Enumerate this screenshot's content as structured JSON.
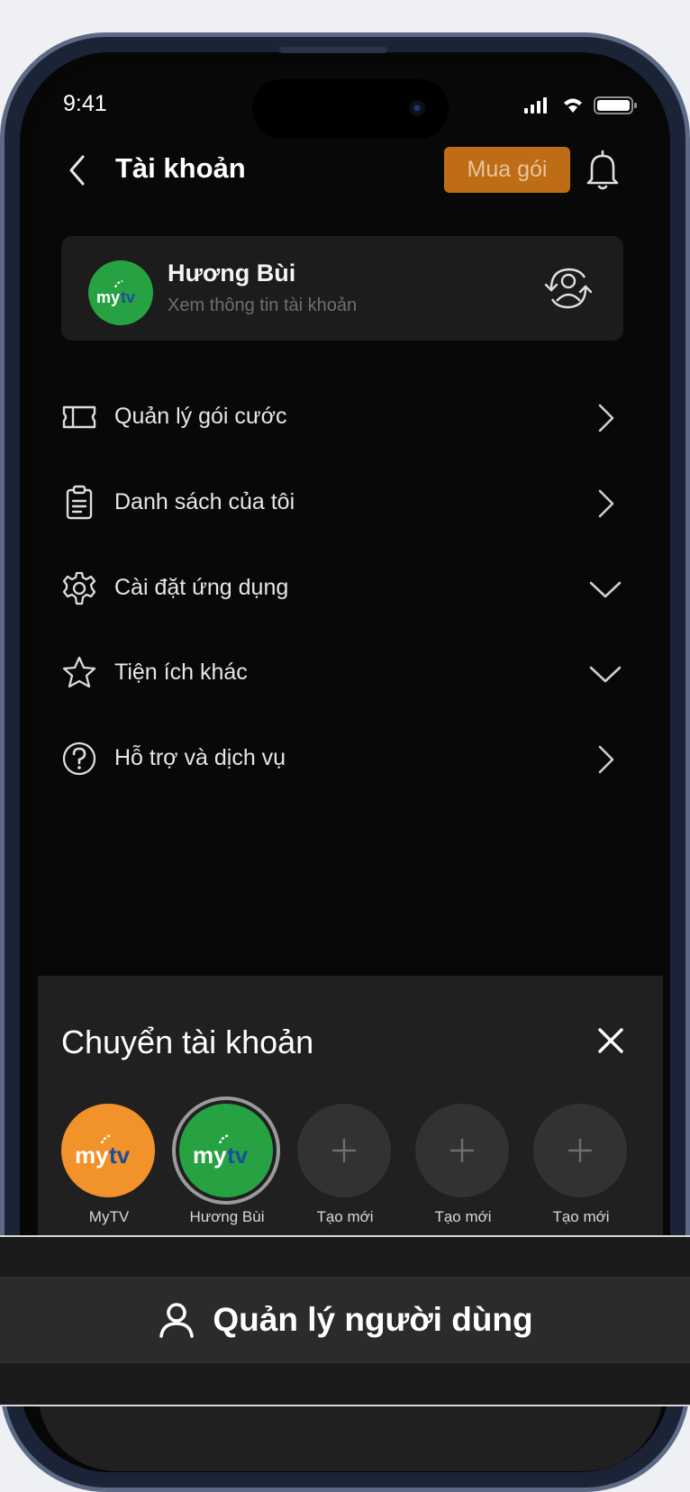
{
  "status_bar": {
    "time": "9:41"
  },
  "header": {
    "title": "Tài khoản",
    "buy_button": "Mua gói"
  },
  "profile": {
    "name": "Hương Bùi",
    "subtitle": "Xem thông tin tài khoản"
  },
  "menu": [
    {
      "label": "Quản lý gói cước",
      "icon": "ticket-icon",
      "arrow": "chevron-right"
    },
    {
      "label": "Danh sách của tôi",
      "icon": "clipboard-icon",
      "arrow": "chevron-right"
    },
    {
      "label": "Cài đặt ứng dụng",
      "icon": "gear-icon",
      "arrow": "chevron-down"
    },
    {
      "label": "Tiện ích khác",
      "icon": "star-icon",
      "arrow": "chevron-down"
    },
    {
      "label": "Hỗ trợ và dịch vụ",
      "icon": "help-icon",
      "arrow": "chevron-right"
    }
  ],
  "switch_sheet": {
    "title": "Chuyển tài khoản",
    "accounts": [
      {
        "label": "MyTV",
        "type": "logo",
        "color": "#f2922a"
      },
      {
        "label": "Hương Bùi",
        "type": "logo",
        "color": "#27a243",
        "selected": true
      },
      {
        "label": "Tạo mới",
        "type": "add"
      },
      {
        "label": "Tạo mới",
        "type": "add"
      },
      {
        "label": "Tạo mới",
        "type": "add"
      }
    ]
  },
  "banner": {
    "label": "Quản lý người dùng"
  },
  "colors": {
    "accent": "#bf6c17",
    "background": "#080808",
    "sheet": "#202020",
    "brand_green": "#27a243",
    "brand_orange": "#f2922a"
  }
}
